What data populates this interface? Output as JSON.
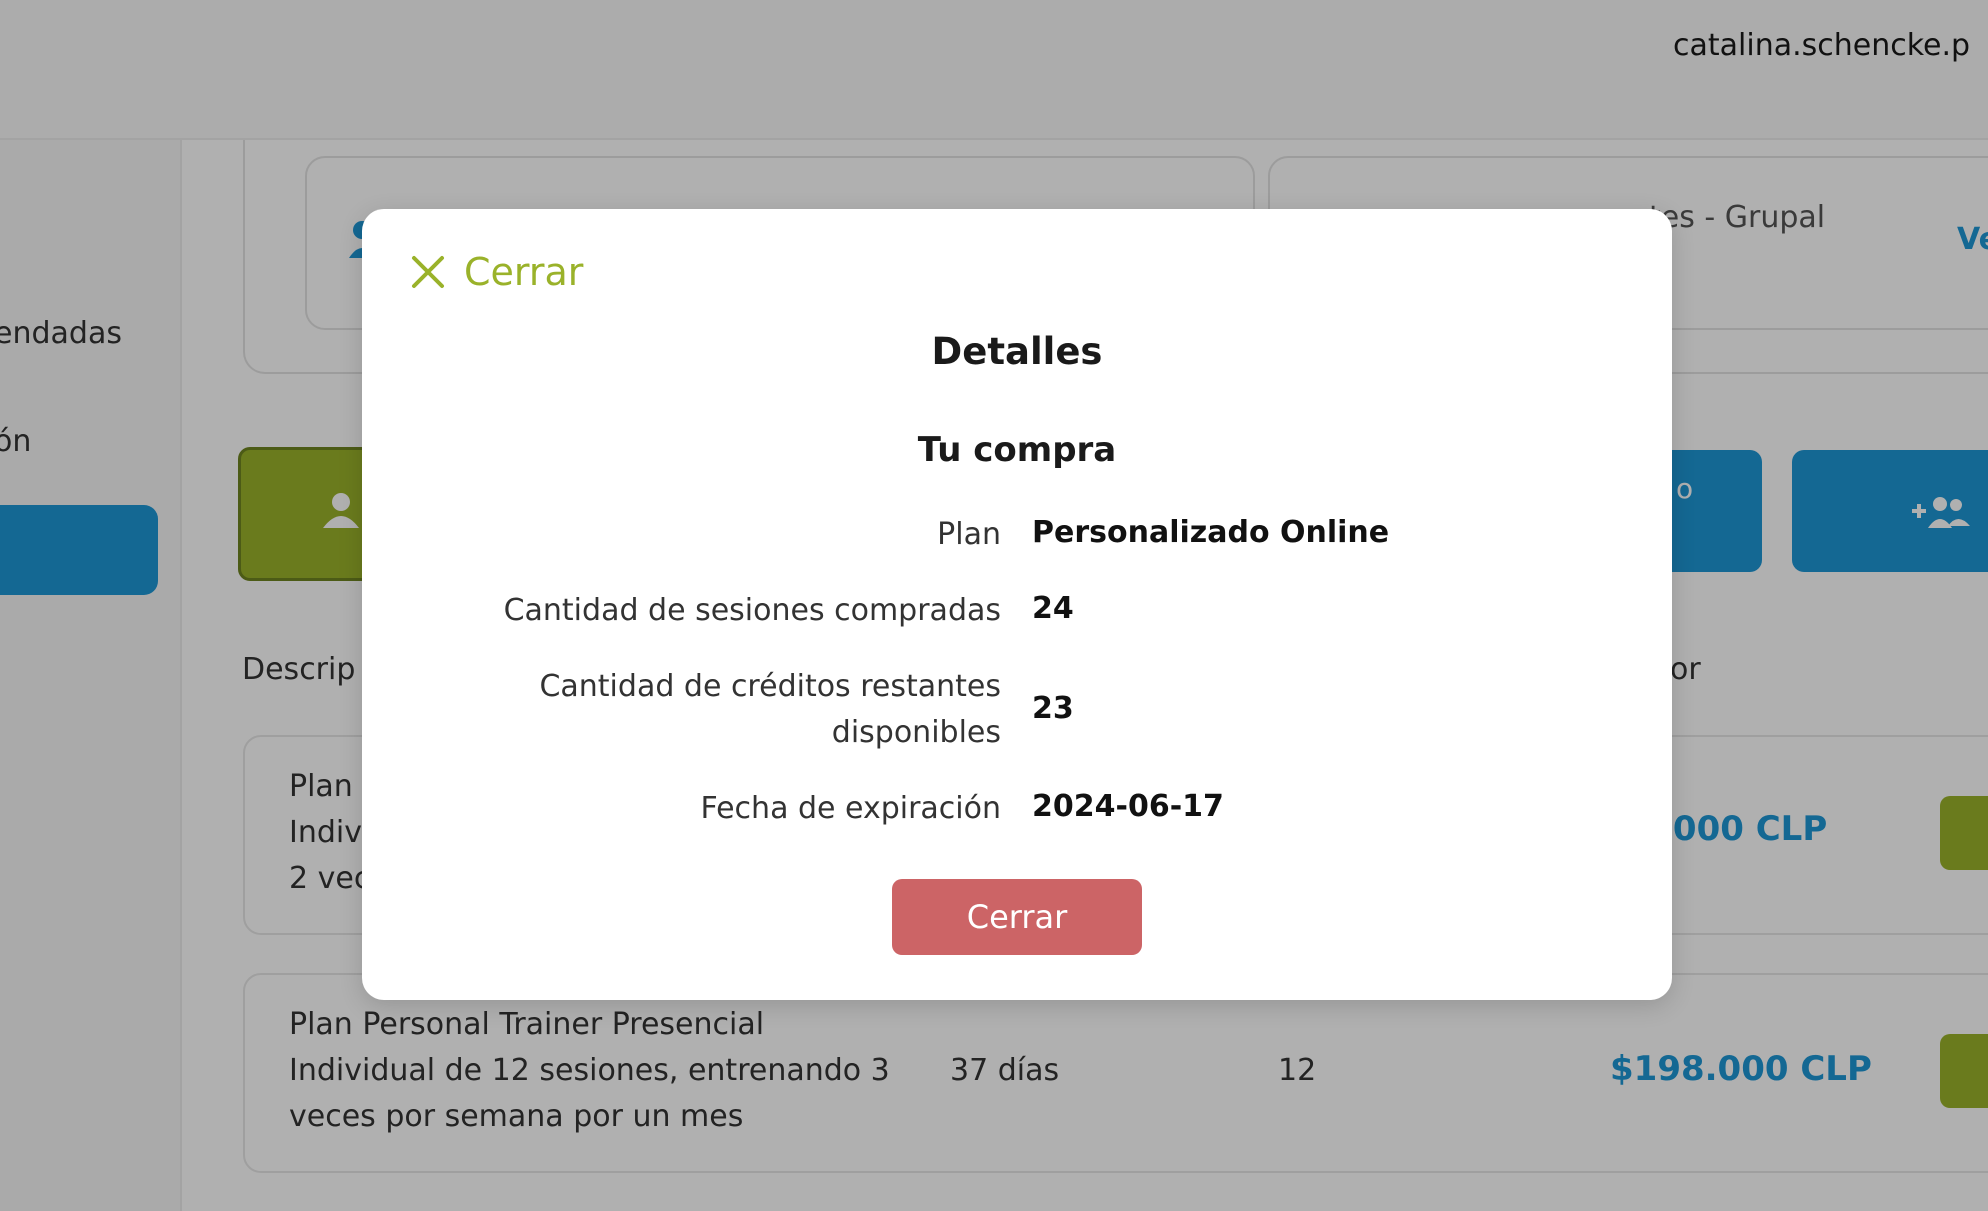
{
  "header": {
    "username": "catalina.schencke.p"
  },
  "sidebar": {
    "items": [
      {
        "label": "endadas"
      },
      {
        "label": "ón"
      }
    ]
  },
  "cards": {
    "card_b_label": "ntes - Grupal",
    "card_b_link": "Ve"
  },
  "buttons": {
    "blue1_label": "o"
  },
  "table": {
    "headers": [
      "Descrip",
      "or"
    ],
    "rows": [
      {
        "description_lines": [
          "Plan",
          "Indiv",
          "2 vec"
        ],
        "price": ".000 CLP"
      },
      {
        "description_lines": [
          "Plan Personal Trainer Presencial",
          "Individual de 12 sesiones, entrenando 3",
          "veces por semana por un mes"
        ],
        "duration": "37 días",
        "sessions": "12",
        "price": "$198.000 CLP"
      }
    ]
  },
  "modal": {
    "close_link": "Cerrar",
    "title": "Detalles",
    "subtitle": "Tu compra",
    "fields": [
      {
        "label": "Plan",
        "value": "Personalizado Online"
      },
      {
        "label": "Cantidad de sesiones compradas",
        "value": "24"
      },
      {
        "label": "Cantidad de créditos restantes disponibles",
        "value": "23"
      },
      {
        "label": "Fecha de expiración",
        "value": "2024-06-17"
      }
    ],
    "close_button": "Cerrar"
  },
  "colors": {
    "accent_green": "#9ab22a",
    "accent_blue": "#1e97d6",
    "danger_button": "#cc6466",
    "overlay": "rgba(0,0,0,0.31)"
  },
  "icons": {
    "close": "close-icon",
    "user": "user-icon",
    "add_group": "add-group-icon"
  }
}
